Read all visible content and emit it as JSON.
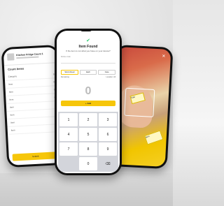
{
  "center_phone": {
    "title": "Item Found",
    "subtitle": "If the item is not what you have on your device?",
    "location_label": "Kitchen Cab",
    "tabs": [
      "Stock Ahead",
      "Each",
      "Case"
    ],
    "meta": {
      "left": "Remaining",
      "right": "Location: All"
    },
    "quantity": "0",
    "add_button": "+ Add",
    "keypad": [
      "1",
      "2",
      "3",
      "4",
      "5",
      "6",
      "7",
      "8",
      "9",
      "",
      "0",
      "⌫"
    ]
  },
  "left_phone": {
    "header_title": "Kitchen Fridge Count 1",
    "section": "Count Items",
    "rows": [
      {
        "left": "Category",
        "right": "0"
      },
      {
        "left": "Item",
        "right": "0"
      },
      {
        "left": "Item",
        "right": "0"
      },
      {
        "left": "Item",
        "right": "0"
      },
      {
        "left": "Item",
        "right": "0"
      },
      {
        "left": "Item",
        "right": "0"
      },
      {
        "left": "Item",
        "right": "0"
      },
      {
        "left": "Item",
        "right": "0"
      }
    ],
    "cta": "Submit"
  },
  "right_phone": {
    "tags": [
      "Sale",
      "Item"
    ]
  },
  "colors": {
    "accent": "#f6c60a",
    "success": "#2ecc71"
  }
}
